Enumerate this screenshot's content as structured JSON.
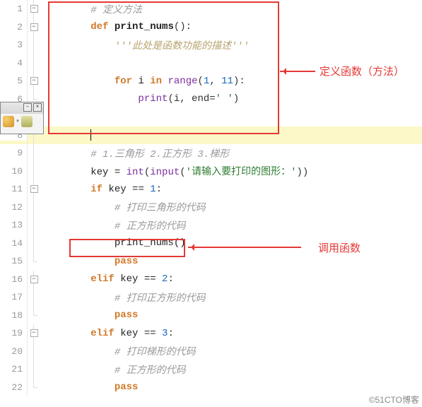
{
  "lines": [
    {
      "n": 1,
      "fold": "minus",
      "seg": [
        {
          "t": "        ",
          "c": ""
        },
        {
          "t": "# 定义方法",
          "c": "cm"
        }
      ]
    },
    {
      "n": 2,
      "fold": "minus",
      "seg": [
        {
          "t": "        ",
          "c": ""
        },
        {
          "t": "def",
          "c": "kw"
        },
        {
          "t": " ",
          "c": ""
        },
        {
          "t": "print_nums",
          "c": "nm"
        },
        {
          "t": "():",
          "c": "op"
        }
      ]
    },
    {
      "n": 3,
      "fold": "bar",
      "seg": [
        {
          "t": "            ",
          "c": ""
        },
        {
          "t": "'''此处是函数功能的描述'''",
          "c": "ds"
        }
      ]
    },
    {
      "n": 4,
      "fold": "bar",
      "seg": [
        {
          "t": "",
          "c": ""
        }
      ]
    },
    {
      "n": 5,
      "fold": "minus",
      "seg": [
        {
          "t": "            ",
          "c": ""
        },
        {
          "t": "for",
          "c": "kw"
        },
        {
          "t": " i ",
          "c": "fn"
        },
        {
          "t": "in",
          "c": "kw"
        },
        {
          "t": " ",
          "c": ""
        },
        {
          "t": "range",
          "c": "bi"
        },
        {
          "t": "(",
          "c": "op"
        },
        {
          "t": "1",
          "c": "nu"
        },
        {
          "t": ", ",
          "c": "op"
        },
        {
          "t": "11",
          "c": "nu"
        },
        {
          "t": "):",
          "c": "op"
        }
      ]
    },
    {
      "n": 6,
      "fold": "end",
      "seg": [
        {
          "t": "                ",
          "c": ""
        },
        {
          "t": "print",
          "c": "bi"
        },
        {
          "t": "(i, end=",
          "c": "op"
        },
        {
          "t": "' '",
          "c": "st"
        },
        {
          "t": ")",
          "c": "op"
        }
      ]
    },
    {
      "n": 7,
      "fold": "",
      "seg": [
        {
          "t": "",
          "c": ""
        }
      ]
    },
    {
      "n": 8,
      "fold": "bar",
      "hl": true,
      "seg": [
        {
          "t": "        ",
          "c": ""
        },
        {
          "t": "|",
          "c": "cursor-mark"
        }
      ]
    },
    {
      "n": 9,
      "fold": "bar",
      "seg": [
        {
          "t": "        ",
          "c": ""
        },
        {
          "t": "# 1.三角形 2.正方形 3.梯形",
          "c": "cm"
        }
      ]
    },
    {
      "n": 10,
      "fold": "bar",
      "seg": [
        {
          "t": "        key = ",
          "c": "fn"
        },
        {
          "t": "int",
          "c": "bi"
        },
        {
          "t": "(",
          "c": "op"
        },
        {
          "t": "input",
          "c": "bi"
        },
        {
          "t": "(",
          "c": "op"
        },
        {
          "t": "'请输入要打印的图形：'",
          "c": "st"
        },
        {
          "t": "))",
          "c": "op"
        }
      ]
    },
    {
      "n": 11,
      "fold": "minus",
      "seg": [
        {
          "t": "        ",
          "c": ""
        },
        {
          "t": "if",
          "c": "kw"
        },
        {
          "t": " key == ",
          "c": "fn"
        },
        {
          "t": "1",
          "c": "nu"
        },
        {
          "t": ":",
          "c": "op"
        }
      ]
    },
    {
      "n": 12,
      "fold": "bar",
      "seg": [
        {
          "t": "            ",
          "c": ""
        },
        {
          "t": "# 打印三角形的代码",
          "c": "cm"
        }
      ]
    },
    {
      "n": 13,
      "fold": "bar",
      "seg": [
        {
          "t": "            ",
          "c": ""
        },
        {
          "t": "# 正方形的代码",
          "c": "cm"
        }
      ]
    },
    {
      "n": 14,
      "fold": "bar",
      "seg": [
        {
          "t": "            print_nums()",
          "c": "fn"
        }
      ]
    },
    {
      "n": 15,
      "fold": "end",
      "seg": [
        {
          "t": "            ",
          "c": ""
        },
        {
          "t": "pass",
          "c": "kw"
        }
      ]
    },
    {
      "n": 16,
      "fold": "minus",
      "seg": [
        {
          "t": "        ",
          "c": ""
        },
        {
          "t": "elif",
          "c": "kw"
        },
        {
          "t": " key == ",
          "c": "fn"
        },
        {
          "t": "2",
          "c": "nu"
        },
        {
          "t": ":",
          "c": "op"
        }
      ]
    },
    {
      "n": 17,
      "fold": "bar",
      "seg": [
        {
          "t": "            ",
          "c": ""
        },
        {
          "t": "# 打印正方形的代码",
          "c": "cm"
        }
      ]
    },
    {
      "n": 18,
      "fold": "end",
      "seg": [
        {
          "t": "            ",
          "c": ""
        },
        {
          "t": "pass",
          "c": "kw"
        }
      ]
    },
    {
      "n": 19,
      "fold": "minus",
      "seg": [
        {
          "t": "        ",
          "c": ""
        },
        {
          "t": "elif",
          "c": "kw"
        },
        {
          "t": " key == ",
          "c": "fn"
        },
        {
          "t": "3",
          "c": "nu"
        },
        {
          "t": ":",
          "c": "op"
        }
      ]
    },
    {
      "n": 20,
      "fold": "bar",
      "seg": [
        {
          "t": "            ",
          "c": ""
        },
        {
          "t": "# 打印梯形的代码",
          "c": "cm"
        }
      ]
    },
    {
      "n": 21,
      "fold": "bar",
      "seg": [
        {
          "t": "            ",
          "c": ""
        },
        {
          "t": "# 正方形的代码",
          "c": "cm"
        }
      ]
    },
    {
      "n": 22,
      "fold": "end",
      "seg": [
        {
          "t": "            ",
          "c": ""
        },
        {
          "t": "pass",
          "c": "kw"
        }
      ]
    }
  ],
  "annotations": {
    "top_box_label": "定义函数（方法）",
    "bottom_box_label": "调用函数"
  },
  "watermark": "©51CTO博客"
}
